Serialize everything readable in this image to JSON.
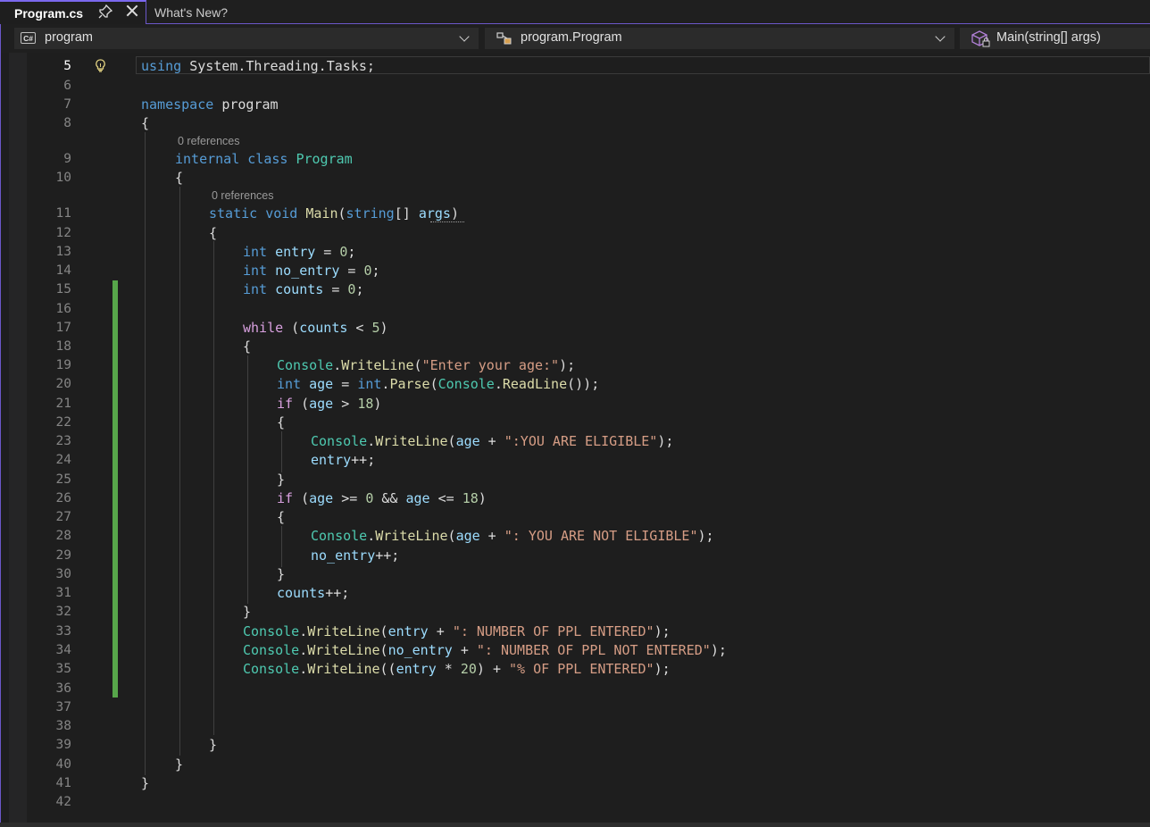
{
  "tabs": [
    {
      "label": "Program.cs",
      "active": true
    },
    {
      "label": "What's New?",
      "active": false
    }
  ],
  "nav": {
    "project": "program",
    "project_badge": "C#",
    "class": "program.Program",
    "member": "Main(string[] args)"
  },
  "code": {
    "line_numbers": [
      "5",
      "6",
      "7",
      "8",
      "9",
      "10",
      "11",
      "12",
      "13",
      "14",
      "15",
      "16",
      "17",
      "18",
      "19",
      "20",
      "21",
      "22",
      "23",
      "24",
      "25",
      "26",
      "27",
      "28",
      "29",
      "30",
      "31",
      "32",
      "33",
      "34",
      "35",
      "36",
      "37",
      "38",
      "39",
      "40",
      "41",
      "42"
    ],
    "references": [
      "0 references",
      "0 references"
    ],
    "lines": {
      "l5": {
        "kw": "using",
        "ns": "System.Threading.Tasks;"
      },
      "l7": {
        "kw": "namespace",
        "name": "program"
      },
      "brace_open": "{",
      "brace_close": "}",
      "l9": {
        "kw1": "internal",
        "kw2": "class",
        "type": "Program"
      },
      "l11": {
        "kw1": "static",
        "kw2": "void",
        "method": "Main",
        "p1": "(",
        "kw3": "string",
        "p2": "[] ",
        "arg": "args",
        "p3": ")"
      },
      "l13": {
        "kw": "int",
        "var": "entry",
        "op": " = ",
        "num": "0",
        "end": ";"
      },
      "l14": {
        "kw": "int",
        "var": "no_entry",
        "op": " = ",
        "num": "0",
        "end": ";"
      },
      "l15": {
        "kw": "int",
        "var": "counts",
        "op": " = ",
        "num": "0",
        "end": ";"
      },
      "l17": {
        "ctl": "while",
        "p1": " (",
        "var": "counts",
        "op": " < ",
        "num": "5",
        "p2": ")"
      },
      "l19": {
        "type": "Console",
        "dot": ".",
        "method": "WriteLine",
        "p1": "(",
        "str": "\"Enter your age:\"",
        "p2": ");"
      },
      "l20": {
        "kw": "int",
        "var": "age",
        "op": " = ",
        "kw2": "int",
        "dot": ".",
        "method": "Parse",
        "p1": "(",
        "type": "Console",
        "dot2": ".",
        "method2": "ReadLine",
        "p2": "());"
      },
      "l21": {
        "ctl": "if",
        "p1": " (",
        "var": "age",
        "op": " > ",
        "num": "18",
        "p2": ")"
      },
      "l23": {
        "type": "Console",
        "dot": ".",
        "method": "WriteLine",
        "p1": "(",
        "var": "age",
        "op": " + ",
        "str": "\":YOU ARE ELIGIBLE\"",
        "p2": ");"
      },
      "l24": {
        "var": "entry",
        "op": "++;"
      },
      "l26": {
        "ctl": "if",
        "p1": " (",
        "var1": "age",
        "op1": " >= ",
        "num1": "0",
        "op2": " && ",
        "var2": "age",
        "op3": " <= ",
        "num2": "18",
        "p2": ")"
      },
      "l28": {
        "type": "Console",
        "dot": ".",
        "method": "WriteLine",
        "p1": "(",
        "var": "age",
        "op": " + ",
        "str": "\": YOU ARE NOT ELIGIBLE\"",
        "p2": ");"
      },
      "l29": {
        "var": "no_entry",
        "op": "++;"
      },
      "l31": {
        "var": "counts",
        "op": "++;"
      },
      "l33": {
        "type": "Console",
        "dot": ".",
        "method": "WriteLine",
        "p1": "(",
        "var": "entry",
        "op": " + ",
        "str": "\": NUMBER OF PPL ENTERED\"",
        "p2": ");"
      },
      "l34": {
        "type": "Console",
        "dot": ".",
        "method": "WriteLine",
        "p1": "(",
        "var": "no_entry",
        "op": " + ",
        "str": "\": NUMBER OF PPL NOT ENTERED\"",
        "p2": ");"
      },
      "l35": {
        "type": "Console",
        "dot": ".",
        "method": "WriteLine",
        "p1": "((",
        "var": "entry",
        "op": " * ",
        "num": "20",
        "p2": ") + ",
        "str": "\"% OF PPL ENTERED\"",
        "p3": ");"
      }
    }
  },
  "colors": {
    "accent": "#7b68ee",
    "keyword": "#569cd6",
    "control": "#d8a0df",
    "type": "#4ec9b0",
    "method": "#dcdcaa",
    "variable": "#9cdcfe",
    "string": "#d69d85",
    "number": "#b5cea8",
    "changed": "#57a64a"
  },
  "icons": [
    "pin-icon",
    "close-icon",
    "csharp-project-icon",
    "class-icon",
    "method-icon",
    "chevron-down-icon",
    "lightbulb-icon"
  ]
}
